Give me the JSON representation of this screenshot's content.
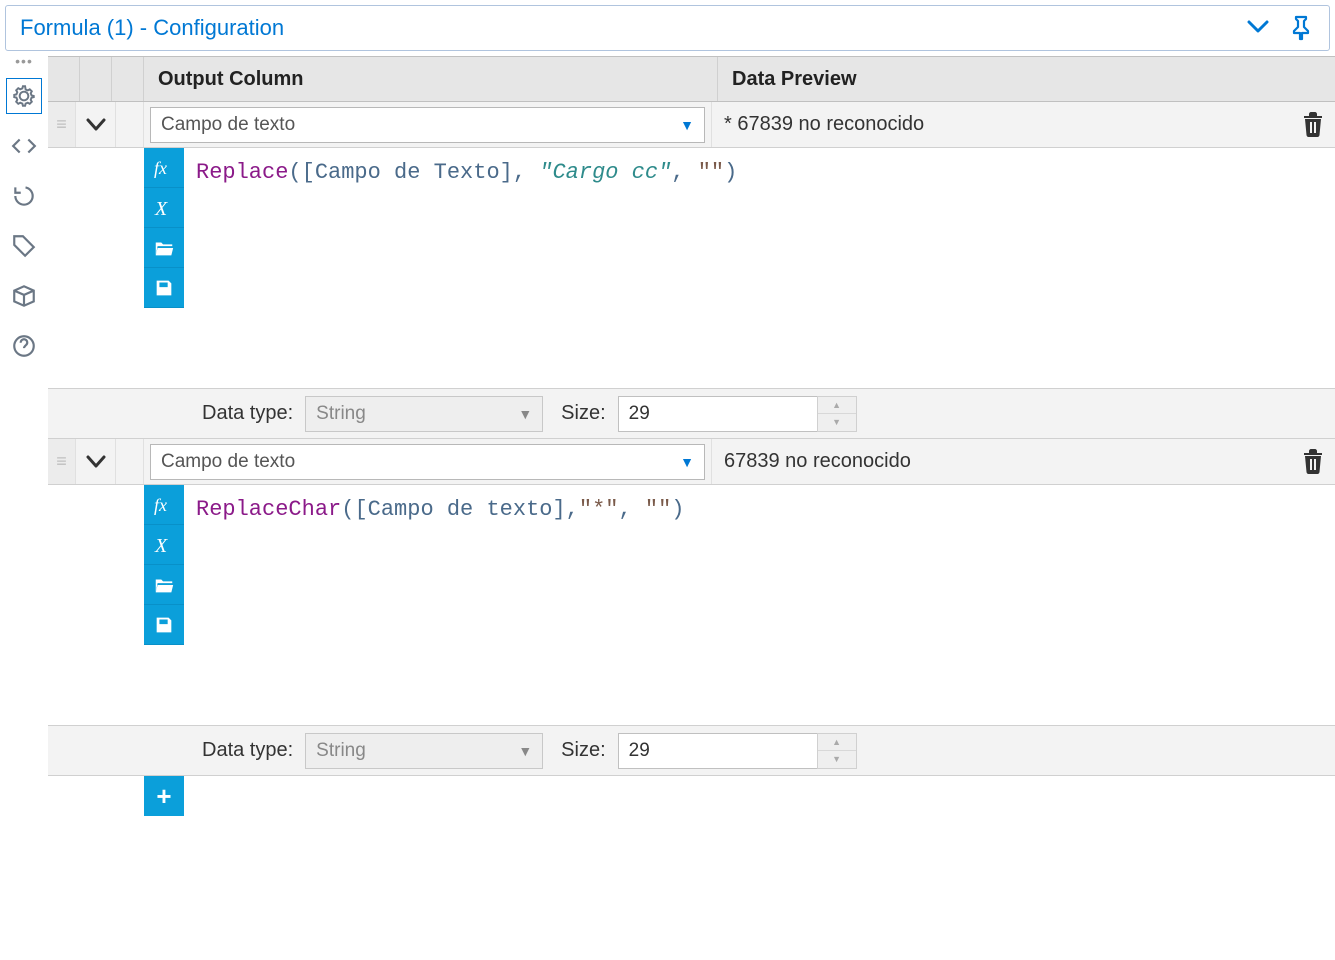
{
  "panel": {
    "title": "Formula (1) - Configuration"
  },
  "headers": {
    "output_column": "Output Column",
    "data_preview": "Data Preview"
  },
  "rows": [
    {
      "output_column": "Campo de texto",
      "preview": "* 67839 no reconocido",
      "formula": {
        "fn": "Replace",
        "field": "[Campo de Texto]",
        "arg1": "\"Cargo cc\"",
        "arg2": "\"\"",
        "arg1_italic": true
      },
      "data_type_label": "Data type:",
      "data_type": "String",
      "size_label": "Size:",
      "size": "29"
    },
    {
      "output_column": "Campo de texto",
      "preview": "67839 no reconocido",
      "formula": {
        "fn": "ReplaceChar",
        "field": "[Campo de texto]",
        "arg1": "\"*\"",
        "arg2": "\"\"",
        "arg1_italic": false
      },
      "data_type_label": "Data type:",
      "data_type": "String",
      "size_label": "Size:",
      "size": "29"
    }
  ],
  "rail_icons": {
    "gear": "gear-icon",
    "code": "code-icon",
    "cycle": "refresh-icon",
    "tag": "tag-icon",
    "box": "package-icon",
    "help": "help-icon"
  }
}
